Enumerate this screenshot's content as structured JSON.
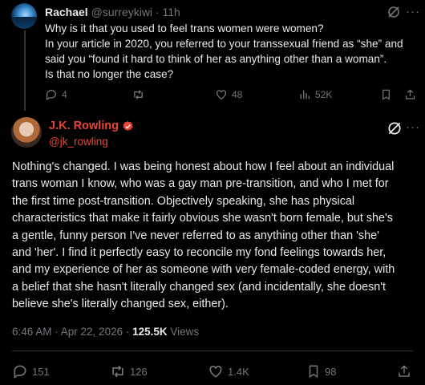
{
  "reply": {
    "author_name": "Rachael",
    "author_handle": "@surreykiwi",
    "separator": "·",
    "time": "11h",
    "text_lines": [
      "Why is it that you used to feel trans women were women?",
      "In your article in 2020, you referred to your transsexual friend as “she” and",
      "said you “found it hard to think of her as anything other than a woman”.",
      "Is that no longer the case?"
    ],
    "replies": "4",
    "reposts": "",
    "likes": "48",
    "views": "52K"
  },
  "main": {
    "author_name": "J.K. Rowling",
    "author_handle": "@jk_rowling",
    "text_lines": [
      "Nothing's changed. I was being honest about how I feel about an individual",
      "trans woman I know, who was a gay man pre-transition, and who I met for",
      "the first time post-transition. Objectively speaking, she has physical",
      "characteristics that make it fairly obvious she wasn't born female, but she's",
      "a gentle, funny person I've never referred to as anything other than 'she'",
      "and 'her'. I find it perfectly easy to reconcile my fond feelings towards her,",
      "and my experience of her as someone with very female-coded energy, with",
      "a belief that she hasn't literally changed sex (and incidentally, she doesn't",
      "believe she's literally changed sex, either)."
    ],
    "timestamp": "6:46 AM · Apr 22, 2026 · ",
    "views_count": "125.5K",
    "views_label": " Views",
    "replies": "151",
    "reposts": "126",
    "likes": "1.4K",
    "bookmarks": "98"
  },
  "colors": {
    "background": "#000000",
    "text": "#e7e9ea",
    "muted": "#71767b",
    "accent_name": "#e8443a",
    "verified": "#e8443a"
  },
  "icons": [
    "grok-icon",
    "more-icon",
    "reply-icon",
    "repost-icon",
    "like-icon",
    "views-icon",
    "bookmark-icon",
    "share-icon",
    "verified-badge-icon"
  ]
}
